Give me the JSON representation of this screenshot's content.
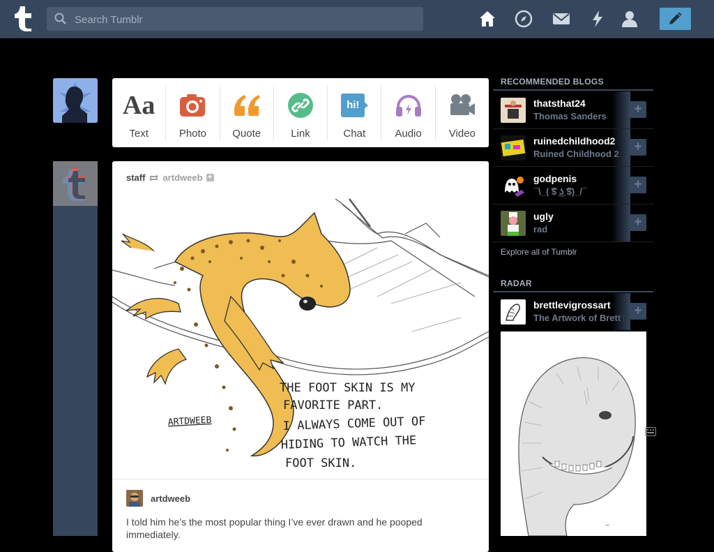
{
  "header": {
    "search_placeholder": "Search Tumblr",
    "nav": [
      "home-icon",
      "explore-icon",
      "inbox-icon",
      "activity-icon",
      "account-icon"
    ],
    "compose": "compose-pencil-icon"
  },
  "post_types": [
    {
      "label": "Text",
      "icon": "text-icon",
      "glyph": "Aa",
      "color": "#444444"
    },
    {
      "label": "Photo",
      "icon": "photo-icon",
      "color": "#d95e40"
    },
    {
      "label": "Quote",
      "icon": "quote-icon",
      "glyph": "“",
      "color": "#f2992e"
    },
    {
      "label": "Link",
      "icon": "link-icon",
      "color": "#56bc8a"
    },
    {
      "label": "Chat",
      "icon": "chat-icon",
      "glyph": "hi!",
      "color": "#529ecc"
    },
    {
      "label": "Audio",
      "icon": "audio-icon",
      "color": "#a77dc2"
    },
    {
      "label": "Video",
      "icon": "video-icon",
      "color": "#748089"
    }
  ],
  "post": {
    "reblogger": "staff",
    "source": "artdweeb",
    "artwork_text": {
      "signature": "ARTDWEEB",
      "lines": [
        "THE FOOT SKIN IS MY",
        "FAVORITE PART.",
        "I ALWAYS COME OUT OF",
        "HIDING TO WATCH THE",
        "FOOT SKIN."
      ]
    },
    "author": "artdweeb",
    "caption": "I told him he’s the most popular thing I’ve ever drawn and he pooped immediately."
  },
  "sidebar": {
    "recommended_title": "RECOMMENDED BLOGS",
    "recommended": [
      {
        "name": "thatsthat24",
        "subtitle": "Thomas Sanders"
      },
      {
        "name": "ruinedchildhood2",
        "subtitle": "Ruined Childhood 2"
      },
      {
        "name": "godpenis",
        "subtitle": "¯\\_( ͡$ ͜ʖ ͡$)_/¯"
      },
      {
        "name": "ugly",
        "subtitle": "rad"
      }
    ],
    "explore_label": "Explore all of Tumblr",
    "radar_title": "RADAR",
    "radar": {
      "name": "brettlevigrossart",
      "subtitle": "The Artwork of Brett Levigross"
    }
  }
}
